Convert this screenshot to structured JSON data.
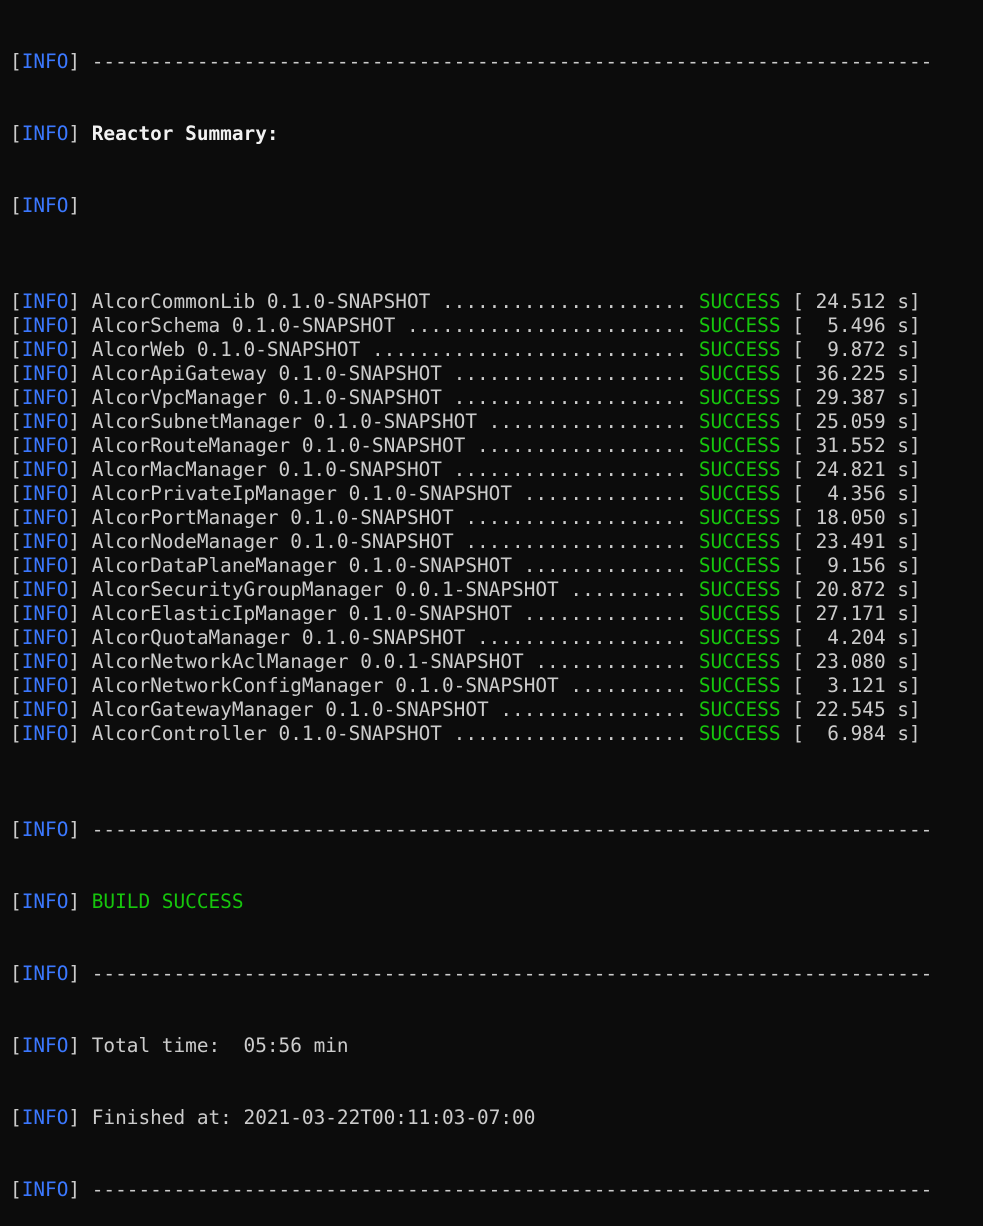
{
  "terminal": {
    "level": "INFO",
    "separator": "------------------------------------------------------------------------",
    "reactor_summary_title": "Reactor Summary:",
    "modules": [
      {
        "name_version": "AlcorCommonLib 0.1.0-SNAPSHOT",
        "status": "SUCCESS",
        "time": "24.512"
      },
      {
        "name_version": "AlcorSchema 0.1.0-SNAPSHOT",
        "status": "SUCCESS",
        "time": "5.496"
      },
      {
        "name_version": "AlcorWeb 0.1.0-SNAPSHOT",
        "status": "SUCCESS",
        "time": "9.872"
      },
      {
        "name_version": "AlcorApiGateway 0.1.0-SNAPSHOT",
        "status": "SUCCESS",
        "time": "36.225"
      },
      {
        "name_version": "AlcorVpcManager 0.1.0-SNAPSHOT",
        "status": "SUCCESS",
        "time": "29.387"
      },
      {
        "name_version": "AlcorSubnetManager 0.1.0-SNAPSHOT",
        "status": "SUCCESS",
        "time": "25.059"
      },
      {
        "name_version": "AlcorRouteManager 0.1.0-SNAPSHOT",
        "status": "SUCCESS",
        "time": "31.552"
      },
      {
        "name_version": "AlcorMacManager 0.1.0-SNAPSHOT",
        "status": "SUCCESS",
        "time": "24.821"
      },
      {
        "name_version": "AlcorPrivateIpManager 0.1.0-SNAPSHOT",
        "status": "SUCCESS",
        "time": "4.356"
      },
      {
        "name_version": "AlcorPortManager 0.1.0-SNAPSHOT",
        "status": "SUCCESS",
        "time": "18.050"
      },
      {
        "name_version": "AlcorNodeManager 0.1.0-SNAPSHOT",
        "status": "SUCCESS",
        "time": "23.491"
      },
      {
        "name_version": "AlcorDataPlaneManager 0.1.0-SNAPSHOT",
        "status": "SUCCESS",
        "time": "9.156"
      },
      {
        "name_version": "AlcorSecurityGroupManager 0.0.1-SNAPSHOT",
        "status": "SUCCESS",
        "time": "20.872"
      },
      {
        "name_version": "AlcorElasticIpManager 0.1.0-SNAPSHOT",
        "status": "SUCCESS",
        "time": "27.171"
      },
      {
        "name_version": "AlcorQuotaManager 0.1.0-SNAPSHOT",
        "status": "SUCCESS",
        "time": "4.204"
      },
      {
        "name_version": "AlcorNetworkAclManager 0.0.1-SNAPSHOT",
        "status": "SUCCESS",
        "time": "23.080"
      },
      {
        "name_version": "AlcorNetworkConfigManager 0.1.0-SNAPSHOT",
        "status": "SUCCESS",
        "time": "3.121"
      },
      {
        "name_version": "AlcorGatewayManager 0.1.0-SNAPSHOT",
        "status": "SUCCESS",
        "time": "22.545"
      },
      {
        "name_version": "AlcorController 0.1.0-SNAPSHOT",
        "status": "SUCCESS",
        "time": "6.984"
      }
    ],
    "build_result": "BUILD SUCCESS",
    "total_time_label": "Total time:",
    "total_time_value": "05:56 min",
    "finished_at_label": "Finished at:",
    "finished_at_value": "2021-03-22T00:11:03-07:00"
  },
  "colors": {
    "background": "#0c0c0c",
    "text": "#cccccc",
    "info_level": "#3b78ff",
    "success": "#16c60c",
    "heading": "#f2f2f2"
  }
}
